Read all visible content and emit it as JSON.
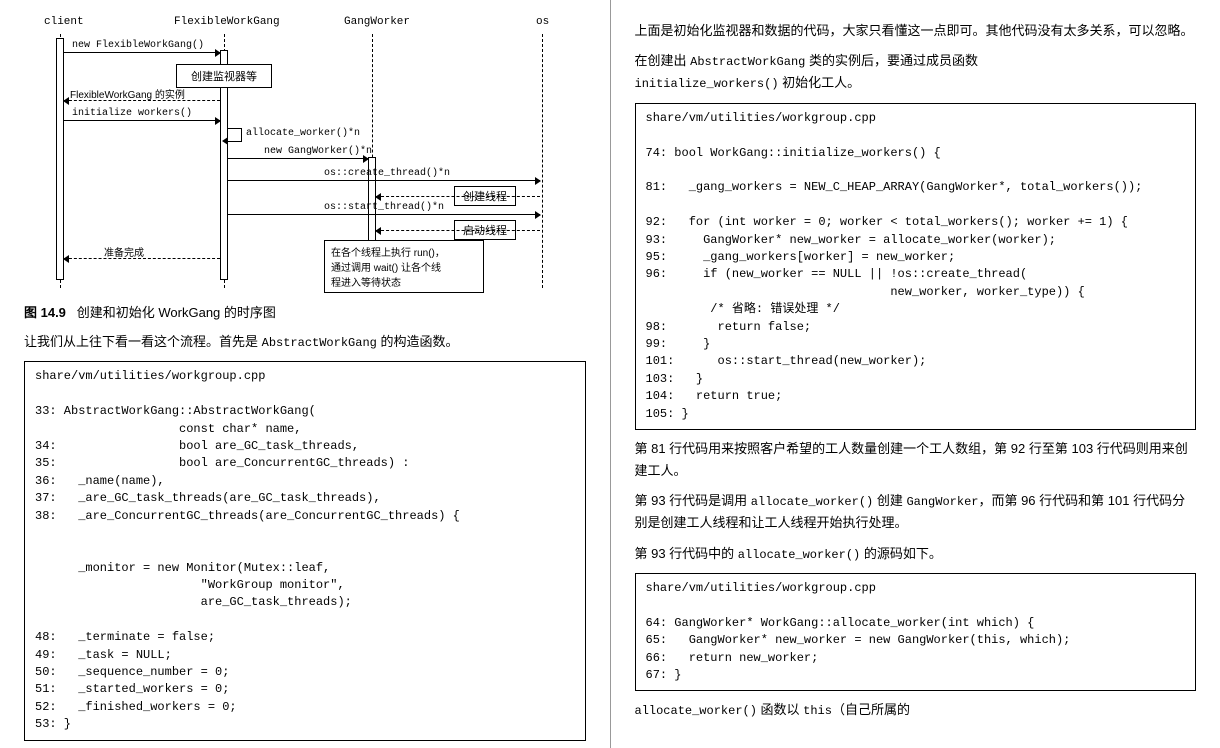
{
  "seq": {
    "lanes": {
      "client": "client",
      "gang": "FlexibleWorkGang",
      "worker": "GangWorker",
      "os": "os"
    },
    "msgs": {
      "new_flex": "new FlexibleWorkGang()",
      "create_monitor": "创建监视器等",
      "flex_instance": "FlexibleWorkGang 的实例",
      "init_workers": "initialize workers()",
      "alloc_worker": "allocate_worker()*n",
      "new_gw": "new GangWorker()*n",
      "create_thread": "os::create_thread()*n",
      "create_thread_label": "创建线程",
      "start_thread": "os::start_thread()*n",
      "start_thread_label": "启动线程",
      "ready": "准备完成",
      "note": "在各个线程上执行 run()，\n通过调用 wait() 让各个线\n程进入等待状态"
    }
  },
  "fig_caption_prefix": "图 14.9",
  "fig_caption_body": "创建和初始化 WorkGang 的时序图",
  "left_p1_a": "让我们从上往下看一看这个流程。首先是 ",
  "left_p1_code": "AbstractWorkGang",
  "left_p1_b": " 的构造函数。",
  "code1": "share/vm/utilities/workgroup.cpp\n\n33: AbstractWorkGang::AbstractWorkGang(\n                    const char* name,\n34:                 bool are_GC_task_threads,\n35:                 bool are_ConcurrentGC_threads) :\n36:   _name(name),\n37:   _are_GC_task_threads(are_GC_task_threads),\n38:   _are_ConcurrentGC_threads(are_ConcurrentGC_threads) {\n\n\n      _monitor = new Monitor(Mutex::leaf,\n                       \"WorkGroup monitor\",\n                       are_GC_task_threads);\n\n48:   _terminate = false;\n49:   _task = NULL;\n50:   _sequence_number = 0;\n51:   _started_workers = 0;\n52:   _finished_workers = 0;\n53: }",
  "right_p1": "上面是初始化监视器和数据的代码，大家只看懂这一点即可。其他代码没有太多关系，可以忽略。",
  "right_p2_a": "在创建出 ",
  "right_p2_code1": "AbstractWorkGang",
  "right_p2_b": " 类的实例后，要通过成员函数 ",
  "right_p2_code2": "initialize_workers()",
  "right_p2_c": " 初始化工人。",
  "code2": "share/vm/utilities/workgroup.cpp\n\n74: bool WorkGang::initialize_workers() {\n\n81:   _gang_workers = NEW_C_HEAP_ARRAY(GangWorker*, total_workers());\n\n92:   for (int worker = 0; worker < total_workers(); worker += 1) {\n93:     GangWorker* new_worker = allocate_worker(worker);\n95:     _gang_workers[worker] = new_worker;\n96:     if (new_worker == NULL || !os::create_thread(\n                                  new_worker, worker_type)) {\n         /* 省略: 错误处理 */\n98:       return false;\n99:     }\n101:      os::start_thread(new_worker);\n103:   }\n104:   return true;\n105: }",
  "right_p3": "第 81 行代码用来按照客户希望的工人数量创建一个工人数组，第 92 行至第 103 行代码则用来创建工人。",
  "right_p4_a": "第 93 行代码是调用 ",
  "right_p4_code1": "allocate_worker()",
  "right_p4_b": " 创建 ",
  "right_p4_code2": "GangWorker",
  "right_p4_c": "，而第 96 行代码和第 101 行代码分别是创建工人线程和让工人线程开始执行处理。",
  "right_p5_a": "第 93 行代码中的 ",
  "right_p5_code": "allocate_worker()",
  "right_p5_b": " 的源码如下。",
  "code3": "share/vm/utilities/workgroup.cpp\n\n64: GangWorker* WorkGang::allocate_worker(int which) {\n65:   GangWorker* new_worker = new GangWorker(this, which);\n66:   return new_worker;\n67: }",
  "right_p6_code": "allocate_worker()",
  "right_p6_a": " 函数以 ",
  "right_p6_code2": "this",
  "right_p6_b": "（自己所属的"
}
